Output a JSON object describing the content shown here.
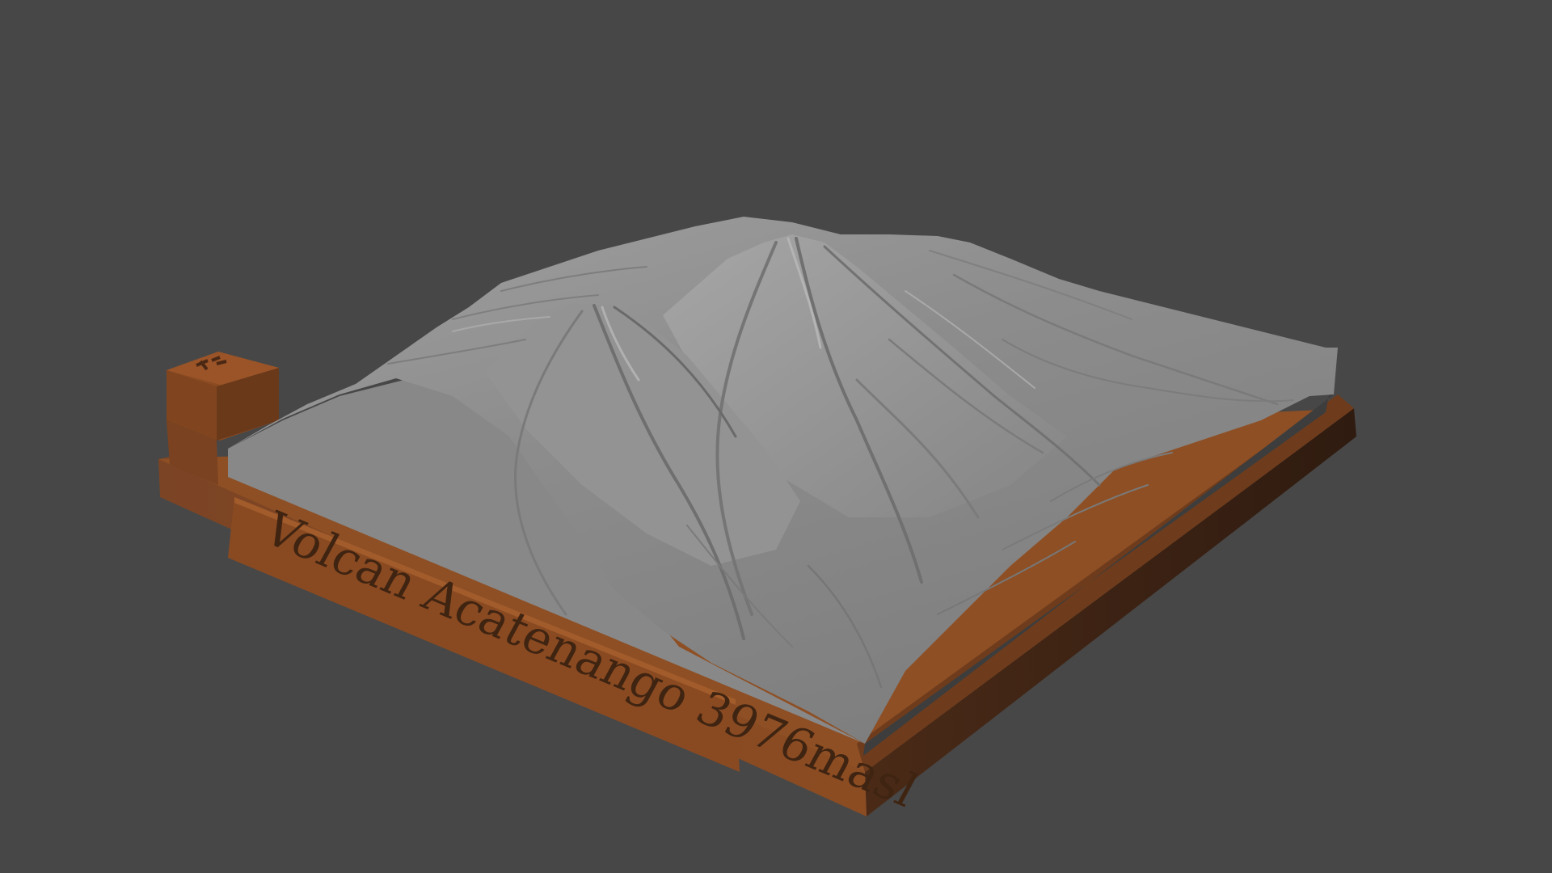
{
  "scene": {
    "background_color": "#474747",
    "base_color": "#8b4c22",
    "base_shadow_color": "#3c2314",
    "terrain_color": "#8e8e8e",
    "terrain_side_color": "#3e3e3e",
    "plate_label": "Volcan Acatenango 3976masl"
  }
}
